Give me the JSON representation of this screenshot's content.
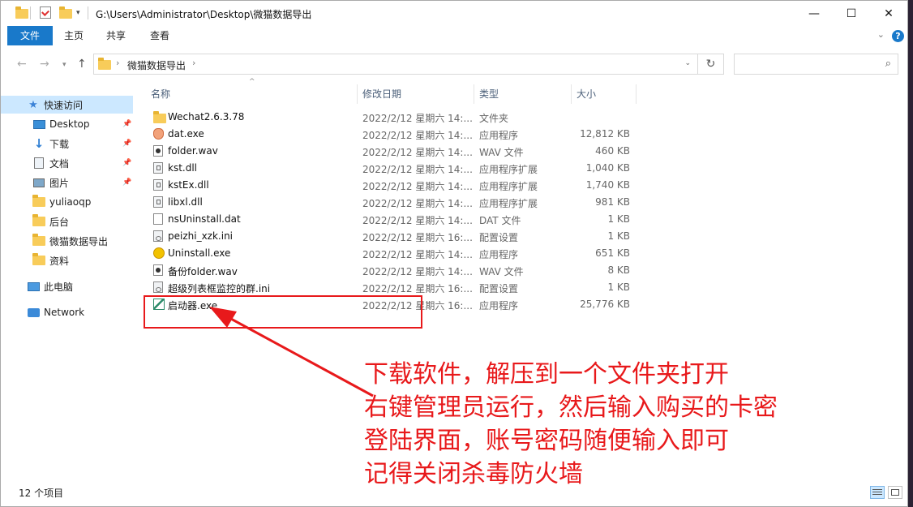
{
  "titlebar": {
    "path": "G:\\Users\\Administrator\\Desktop\\微猫数据导出",
    "minimize": "—",
    "maximize": "☐",
    "close": "✕"
  },
  "ribbon": {
    "tabs": [
      "文件",
      "主页",
      "共享",
      "查看"
    ],
    "help": "?"
  },
  "address": {
    "folder": "微猫数据导出"
  },
  "sidebar": {
    "items": [
      {
        "label": "快速访问",
        "icon": "star-icon"
      },
      {
        "label": "Desktop",
        "icon": "desktop-icon"
      },
      {
        "label": "下载",
        "icon": "download-icon"
      },
      {
        "label": "文档",
        "icon": "document-icon"
      },
      {
        "label": "图片",
        "icon": "picture-icon"
      },
      {
        "label": "yuliaoqp",
        "icon": "folder-icon"
      },
      {
        "label": "后台",
        "icon": "folder-icon"
      },
      {
        "label": "微猫数据导出",
        "icon": "folder-icon"
      },
      {
        "label": "资料",
        "icon": "folder-icon"
      },
      {
        "label": "此电脑",
        "icon": "computer-icon"
      },
      {
        "label": "Network",
        "icon": "network-icon"
      }
    ]
  },
  "columns": {
    "name": "名称",
    "date": "修改日期",
    "type": "类型",
    "size": "大小"
  },
  "files": [
    {
      "name": "Wechat2.6.3.78",
      "date": "2022/2/12 星期六 14:...",
      "type": "文件夹",
      "size": "",
      "icon": "folder-icon"
    },
    {
      "name": "dat.exe",
      "date": "2022/2/12 星期六 14:...",
      "type": "应用程序",
      "size": "12,812 KB",
      "icon": "exe-shield-icon"
    },
    {
      "name": "folder.wav",
      "date": "2022/2/12 星期六 14:...",
      "type": "WAV 文件",
      "size": "460 KB",
      "icon": "audio-file-icon"
    },
    {
      "name": "kst.dll",
      "date": "2022/2/12 星期六 14:...",
      "type": "应用程序扩展",
      "size": "1,040 KB",
      "icon": "dll-file-icon"
    },
    {
      "name": "kstEx.dll",
      "date": "2022/2/12 星期六 14:...",
      "type": "应用程序扩展",
      "size": "1,740 KB",
      "icon": "dll-file-icon"
    },
    {
      "name": "libxl.dll",
      "date": "2022/2/12 星期六 14:...",
      "type": "应用程序扩展",
      "size": "981 KB",
      "icon": "dll-file-icon"
    },
    {
      "name": "nsUninstall.dat",
      "date": "2022/2/12 星期六 14:...",
      "type": "DAT 文件",
      "size": "1 KB",
      "icon": "blank-file-icon"
    },
    {
      "name": "peizhi_xzk.ini",
      "date": "2022/2/12 星期六 16:...",
      "type": "配置设置",
      "size": "1 KB",
      "icon": "ini-file-icon"
    },
    {
      "name": "Uninstall.exe",
      "date": "2022/2/12 星期六 14:...",
      "type": "应用程序",
      "size": "651 KB",
      "icon": "uninstall-icon"
    },
    {
      "name": "备份folder.wav",
      "date": "2022/2/12 星期六 14:...",
      "type": "WAV 文件",
      "size": "8 KB",
      "icon": "audio-file-icon"
    },
    {
      "name": "超级列表框监控的群.ini",
      "date": "2022/2/12 星期六 16:...",
      "type": "配置设置",
      "size": "1 KB",
      "icon": "ini-file-icon"
    },
    {
      "name": "启动器.exe",
      "date": "2022/2/12 星期六 16:...",
      "type": "应用程序",
      "size": "25,776 KB",
      "icon": "launcher-icon"
    }
  ],
  "status": {
    "count": "12 个项目"
  },
  "annotation": {
    "lines": [
      "下载软件，解压到一个文件夹打开",
      "右键管理员运行，然后输入购买的卡密",
      "登陆界面，账号密码随便输入即可",
      "记得关闭杀毒防火墙"
    ],
    "color": "#e8191b"
  },
  "colors": {
    "accent": "#1979ca",
    "selection": "#cce8ff"
  }
}
